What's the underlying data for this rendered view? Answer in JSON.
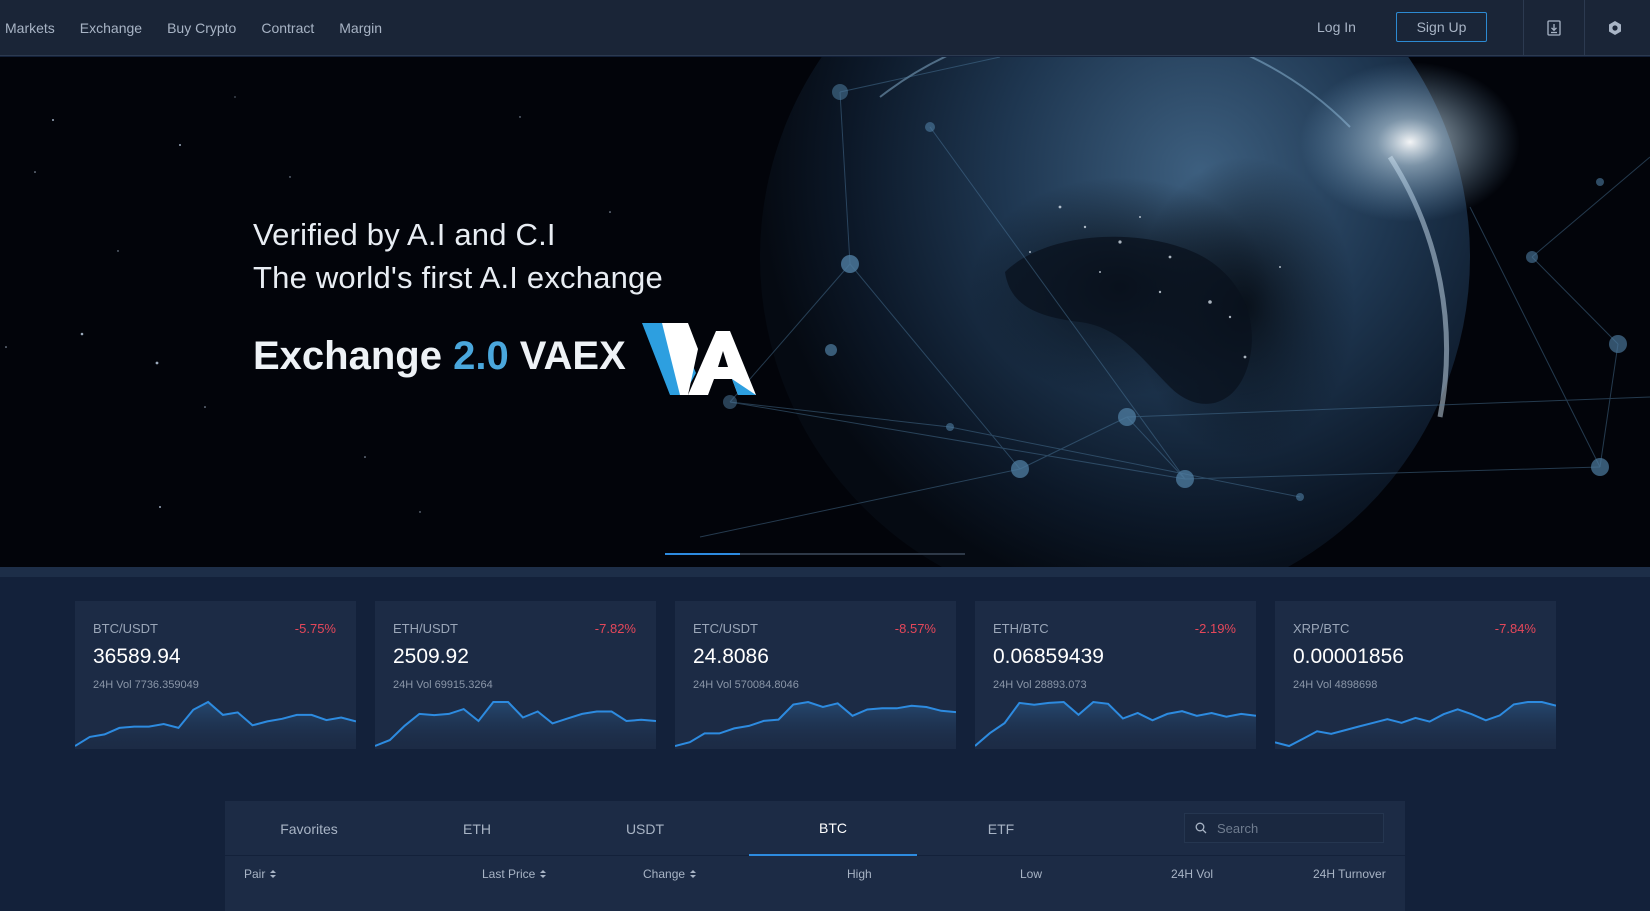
{
  "nav": {
    "links": [
      "Markets",
      "Exchange",
      "Buy Crypto",
      "Contract",
      "Margin"
    ],
    "login_label": "Log In",
    "signup_label": "Sign Up",
    "icons": [
      "download-icon",
      "settings-hexagon-icon"
    ]
  },
  "hero": {
    "line1": "Verified by A.I and C.I",
    "line2": "The world's first A.I exchange",
    "big_prefix": "Exchange ",
    "big_accent": "2.0",
    "big_suffix": " VAEX",
    "logo_text": "VA",
    "slider_progress": 0.25
  },
  "colors": {
    "accent": "#2d8be0",
    "negative": "#e5475a",
    "card": "#1c2b45"
  },
  "tickers": [
    {
      "pair": "BTC/USDT",
      "change": "-5.75%",
      "price": "36589.94",
      "vol": "24H Vol 7736.359049",
      "series": [
        2,
        9,
        11,
        16,
        17,
        17,
        19,
        16,
        30,
        36,
        26,
        28,
        18,
        21,
        23,
        26,
        26,
        22,
        24,
        21
      ]
    },
    {
      "pair": "ETH/USDT",
      "change": "-7.82%",
      "price": "2509.92",
      "vol": "24H Vol 69915.3264",
      "series": [
        3,
        8,
        20,
        30,
        29,
        30,
        34,
        24,
        40,
        40,
        27,
        32,
        22,
        26,
        30,
        32,
        32,
        24,
        25,
        24
      ]
    },
    {
      "pair": "ETC/USDT",
      "change": "-8.57%",
      "price": "24.8086",
      "vol": "24H Vol 570084.8046",
      "series": [
        2,
        5,
        12,
        12,
        16,
        18,
        22,
        23,
        35,
        37,
        33,
        36,
        26,
        31,
        32,
        32,
        34,
        33,
        30,
        29
      ]
    },
    {
      "pair": "ETH/BTC",
      "change": "-2.19%",
      "price": "0.06859439",
      "vol": "24H Vol 28893.073",
      "series": [
        0,
        14,
        25,
        47,
        45,
        47,
        48,
        34,
        48,
        46,
        30,
        36,
        28,
        35,
        38,
        33,
        36,
        32,
        35,
        33
      ]
    },
    {
      "pair": "XRP/BTC",
      "change": "-7.84%",
      "price": "0.00001856",
      "vol": "24H Vol 4898698",
      "series": [
        5,
        2,
        8,
        14,
        12,
        15,
        18,
        21,
        24,
        21,
        25,
        22,
        28,
        32,
        28,
        23,
        27,
        36,
        38,
        38,
        35
      ]
    }
  ],
  "market": {
    "tabs": [
      "Favorites",
      "ETH",
      "USDT",
      "BTC",
      "ETF"
    ],
    "active_tab": "BTC",
    "search_placeholder": "Search",
    "columns": [
      "Pair",
      "Last Price",
      "Change",
      "High",
      "Low",
      "24H Vol",
      "24H Turnover"
    ]
  }
}
